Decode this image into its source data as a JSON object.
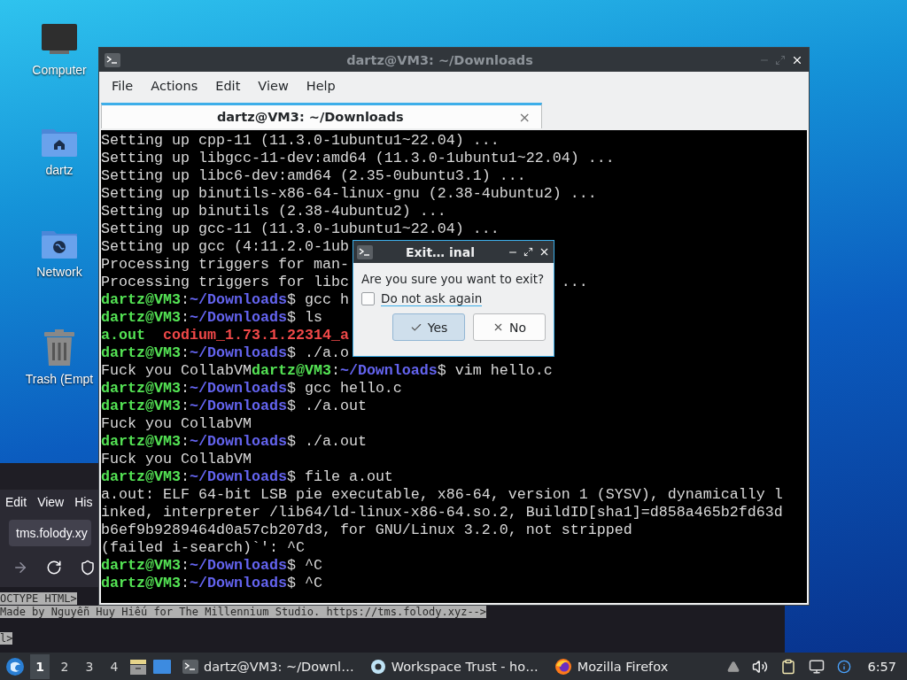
{
  "desktop": {
    "icons": [
      {
        "label": "Computer",
        "kind": "computer"
      },
      {
        "label": "dartz",
        "kind": "home"
      },
      {
        "label": "Network",
        "kind": "network"
      },
      {
        "label": "Trash (Empt",
        "kind": "trash"
      }
    ]
  },
  "browser_window": {
    "menu": [
      "Edit",
      "View",
      "His"
    ],
    "url": "tms.folody.xy",
    "source_lines": [
      {
        "text": "OCTYPE HTML>",
        "after_blank_line": false
      },
      {
        "text": "Made by Nguyễn Huy Hiếu for The Millennium Studio. https://tms.folody.xyz-->",
        "after_blank_line": false
      },
      {
        "text": "l>",
        "after_blank_line": true
      }
    ]
  },
  "terminal_window": {
    "title": "dartz@VM3: ~/Downloads",
    "menu": [
      "File",
      "Actions",
      "Edit",
      "View",
      "Help"
    ],
    "tabs": [
      {
        "label": "dartz@VM3: ~/Downloads",
        "selected": true,
        "close": "×"
      }
    ],
    "lines": [
      {
        "segments": [
          {
            "kind": "plain",
            "text": "Setting up cpp-11 (11.3.0-1ubuntu1~22.04) ..."
          }
        ]
      },
      {
        "segments": [
          {
            "kind": "plain",
            "text": "Setting up libgcc-11-dev:amd64 (11.3.0-1ubuntu1~22.04) ..."
          }
        ]
      },
      {
        "segments": [
          {
            "kind": "plain",
            "text": "Setting up libc6-dev:amd64 (2.35-0ubuntu3.1) ..."
          }
        ]
      },
      {
        "segments": [
          {
            "kind": "plain",
            "text": "Setting up binutils-x86-64-linux-gnu (2.38-4ubuntu2) ..."
          }
        ]
      },
      {
        "segments": [
          {
            "kind": "plain",
            "text": "Setting up binutils (2.38-4ubuntu2) ..."
          }
        ]
      },
      {
        "segments": [
          {
            "kind": "plain",
            "text": "Setting up gcc-11 (11.3.0-1ubuntu1~22.04) ..."
          }
        ]
      },
      {
        "segments": [
          {
            "kind": "plain",
            "text": "Setting up gcc (4:11.2.0-1ub"
          }
        ]
      },
      {
        "segments": [
          {
            "kind": "plain",
            "text": "Processing triggers for man-"
          }
        ]
      },
      {
        "segments": [
          {
            "kind": "plain",
            "text": "Processing triggers for libc"
          },
          {
            "kind": "plain",
            "text": "...",
            "after_dialog": true
          }
        ]
      },
      {
        "segments": [
          {
            "kind": "user",
            "text": "dartz@VM3"
          },
          {
            "kind": "plain",
            "text": ":"
          },
          {
            "kind": "path",
            "text": "~/Downloads"
          },
          {
            "kind": "plain",
            "text": "$ gcc h"
          }
        ]
      },
      {
        "segments": [
          {
            "kind": "user",
            "text": "dartz@VM3"
          },
          {
            "kind": "plain",
            "text": ":"
          },
          {
            "kind": "path",
            "text": "~/Downloads"
          },
          {
            "kind": "plain",
            "text": "$ ls"
          }
        ]
      },
      {
        "segments": [
          {
            "kind": "executable",
            "text": "a.out  "
          },
          {
            "kind": "archive",
            "text": "codium_1.73.1.22314_a"
          }
        ]
      },
      {
        "segments": [
          {
            "kind": "user",
            "text": "dartz@VM3"
          },
          {
            "kind": "plain",
            "text": ":"
          },
          {
            "kind": "path",
            "text": "~/Downloads"
          },
          {
            "kind": "plain",
            "text": "$ ./a.o"
          }
        ]
      },
      {
        "segments": [
          {
            "kind": "plain",
            "text": "Fuck you CollabVM"
          },
          {
            "kind": "user",
            "text": "dartz@VM3"
          },
          {
            "kind": "plain",
            "text": ":"
          },
          {
            "kind": "path",
            "text": "~/Downloads"
          },
          {
            "kind": "plain",
            "text": "$ vim hello.c"
          }
        ]
      },
      {
        "segments": [
          {
            "kind": "user",
            "text": "dartz@VM3"
          },
          {
            "kind": "plain",
            "text": ":"
          },
          {
            "kind": "path",
            "text": "~/Downloads"
          },
          {
            "kind": "plain",
            "text": "$ gcc hello.c"
          }
        ]
      },
      {
        "segments": [
          {
            "kind": "user",
            "text": "dartz@VM3"
          },
          {
            "kind": "plain",
            "text": ":"
          },
          {
            "kind": "path",
            "text": "~/Downloads"
          },
          {
            "kind": "plain",
            "text": "$ ./a.out"
          }
        ]
      },
      {
        "segments": [
          {
            "kind": "plain",
            "text": "Fuck you CollabVM"
          }
        ]
      },
      {
        "segments": [
          {
            "kind": "user",
            "text": "dartz@VM3"
          },
          {
            "kind": "plain",
            "text": ":"
          },
          {
            "kind": "path",
            "text": "~/Downloads"
          },
          {
            "kind": "plain",
            "text": "$ ./a.out"
          }
        ]
      },
      {
        "segments": [
          {
            "kind": "plain",
            "text": "Fuck you CollabVM"
          }
        ]
      },
      {
        "segments": [
          {
            "kind": "user",
            "text": "dartz@VM3"
          },
          {
            "kind": "plain",
            "text": ":"
          },
          {
            "kind": "path",
            "text": "~/Downloads"
          },
          {
            "kind": "plain",
            "text": "$ file a.out"
          }
        ]
      },
      {
        "segments": [
          {
            "kind": "plain",
            "text": "a.out: ELF 64-bit LSB pie executable, x86-64, version 1 (SYSV), dynamically l"
          }
        ]
      },
      {
        "segments": [
          {
            "kind": "plain",
            "text": "inked, interpreter /lib64/ld-linux-x86-64.so.2, BuildID[sha1]=d858a465b2fd63d"
          }
        ]
      },
      {
        "segments": [
          {
            "kind": "plain",
            "text": "b6ef9b9289464d0a57cb207d3, for GNU/Linux 3.2.0, not stripped"
          }
        ]
      },
      {
        "segments": [
          {
            "kind": "plain",
            "text": "(failed i-search)`': ^C"
          }
        ]
      },
      {
        "segments": [
          {
            "kind": "user",
            "text": "dartz@VM3"
          },
          {
            "kind": "plain",
            "text": ":"
          },
          {
            "kind": "path",
            "text": "~/Downloads"
          },
          {
            "kind": "plain",
            "text": "$ ^C"
          }
        ]
      },
      {
        "segments": [
          {
            "kind": "user",
            "text": "dartz@VM3"
          },
          {
            "kind": "plain",
            "text": ":"
          },
          {
            "kind": "path",
            "text": "~/Downloads"
          },
          {
            "kind": "plain",
            "text": "$ ^C"
          }
        ]
      }
    ],
    "dialog": {
      "title": "Exit… inal",
      "message": "Are you sure you want to exit?",
      "checkbox": {
        "label": "Do not ask again",
        "checked": false
      },
      "buttons": [
        {
          "label": "Yes",
          "kind": "yes",
          "default": true
        },
        {
          "label": "No",
          "kind": "no",
          "default": false
        }
      ]
    }
  },
  "taskbar": {
    "workspaces": [
      {
        "label": "1",
        "selected": true
      },
      {
        "label": "2",
        "selected": false
      },
      {
        "label": "3",
        "selected": false
      },
      {
        "label": "4",
        "selected": false
      }
    ],
    "tasks": [
      {
        "label": "dartz@VM3: ~/Downl…",
        "kind": "terminal"
      },
      {
        "label": "Workspace Trust - ho…",
        "kind": "editor"
      },
      {
        "label": "Mozilla Firefox",
        "kind": "browser"
      }
    ],
    "clock": "6:57"
  }
}
